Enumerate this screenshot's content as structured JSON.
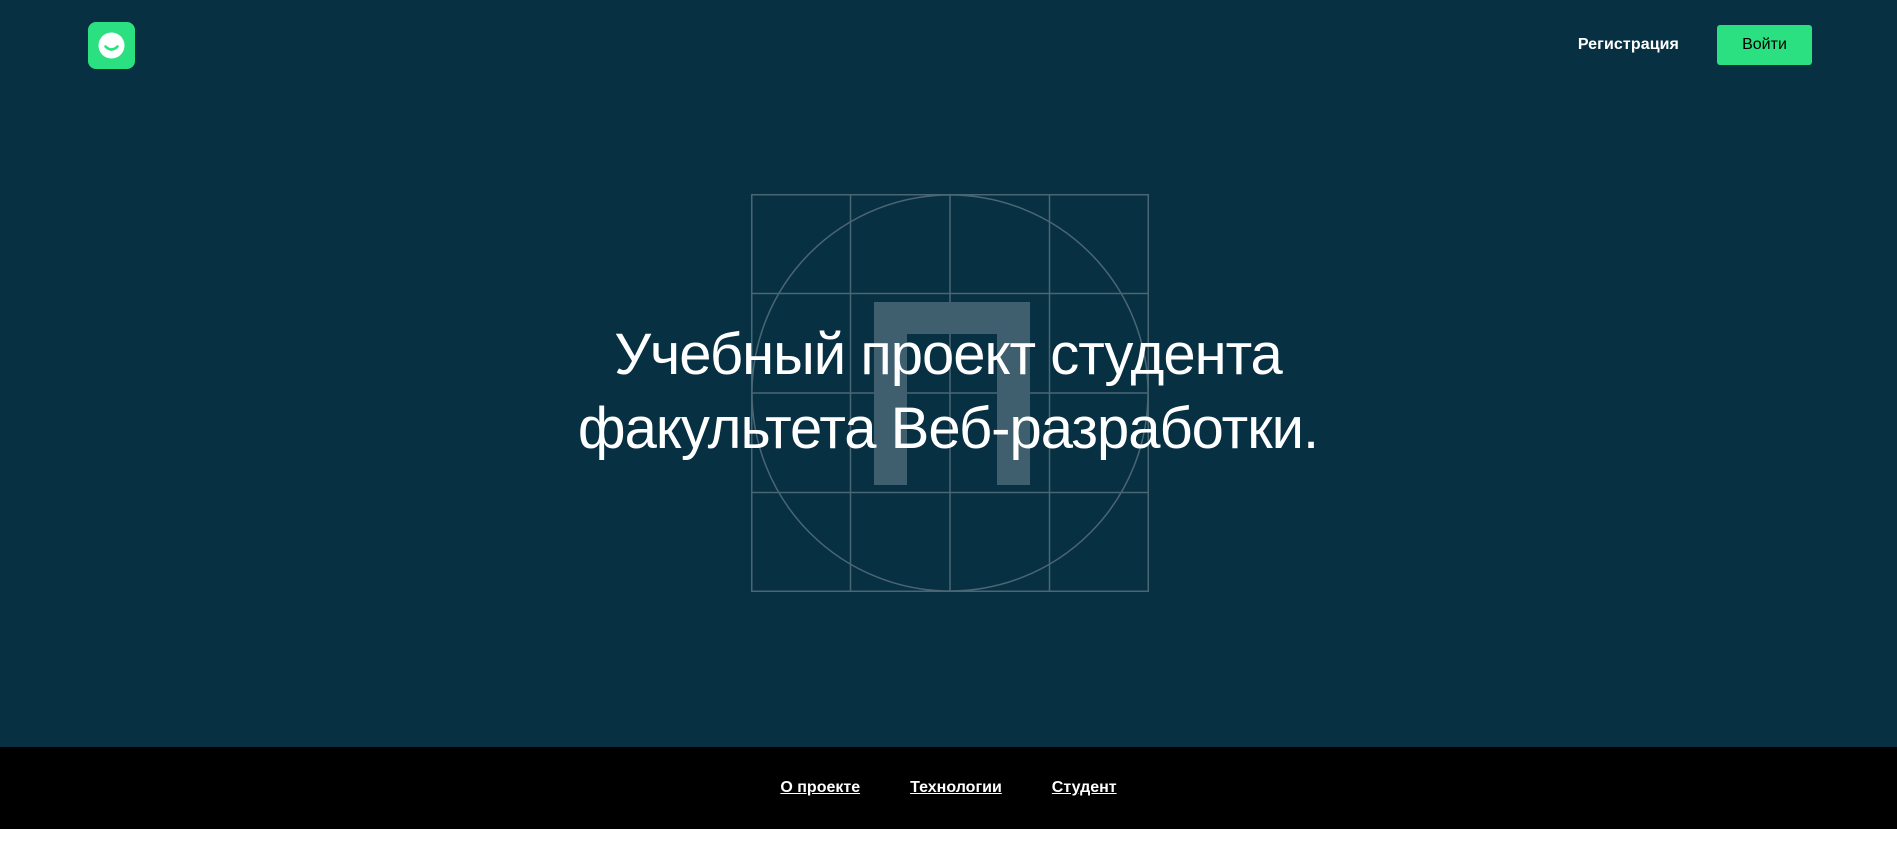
{
  "header": {
    "logo_icon": "smiley-face-icon",
    "register_label": "Регистрация",
    "login_label": "Войти"
  },
  "hero": {
    "title_line1": "Учебный проект студента",
    "title_line2": "факультета Веб-разработки.",
    "emblem_icon": "grid-circle-pi-icon"
  },
  "footer_nav": {
    "items": [
      {
        "label": "О проекте"
      },
      {
        "label": "Технологии"
      },
      {
        "label": "Студент"
      }
    ]
  },
  "colors": {
    "background": "#073042",
    "accent": "#2be080",
    "nav_background": "#000000",
    "grid_lines": "#4a6675",
    "emblem_fill": "#3f5f6f",
    "text": "#ffffff"
  }
}
